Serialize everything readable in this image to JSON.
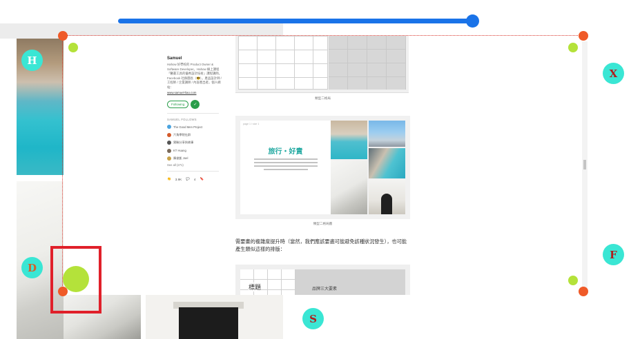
{
  "slider": {
    "value": 1.0
  },
  "article": {
    "author": {
      "name": "Samuel",
      "bio": "Hahow 好學校的 Product Owner & Software Developer。Hahow 線上課程「醫書工具的優秀設計技術」課程講師。Facebook 社群團長（😎）。產品設計師 / 工程師 / 企業講師 / 內容產出者，個人網站：",
      "link": "www.samuel-liao.com",
      "following_label": "Following"
    },
    "follows": {
      "heading": "SAMUEL FOLLOWS",
      "items": [
        {
          "label": "The Good Men Project",
          "color": "#4aa3df"
        },
        {
          "label": "六角學院社群",
          "color": "#d45a2a"
        },
        {
          "label": "實驗分享與故事",
          "color": "#555555"
        },
        {
          "label": "KT Huang",
          "color": "#7a6a5a"
        },
        {
          "label": "陳俊凱 Joel",
          "color": "#c8a24a"
        }
      ],
      "see_all": "See all (271)"
    },
    "stats": {
      "claps": "3.9K",
      "responses": "4"
    },
    "captions": {
      "fig1": "類型二格局",
      "fig2": "類型二格局圖"
    },
    "travel_card": {
      "tag": "page 1 / size 1",
      "title": "旅行・好責"
    },
    "body_text": "需要畫的複雜度提升時（當然，我們應該要盡可能避免該種狀況發生），也可能產生類似這樣的排版：",
    "title_fig": {
      "label": "標題",
      "grey_label": "品牌三大要素"
    }
  },
  "overlay": {
    "badges": [
      {
        "letter": "H",
        "color": "#ffffff"
      },
      {
        "letter": "X",
        "color": "#b01c1c"
      },
      {
        "letter": "D",
        "color": "#d2622a"
      },
      {
        "letter": "F",
        "color": "#b01c1c"
      },
      {
        "letter": "S",
        "color": "#b01c1c"
      }
    ]
  },
  "colors": {
    "accent": "#1a73e8",
    "handle": "#ef5a28",
    "badge": "#3ae6d4",
    "green_dot": "#b4e23a",
    "red_box": "#e0202a"
  }
}
